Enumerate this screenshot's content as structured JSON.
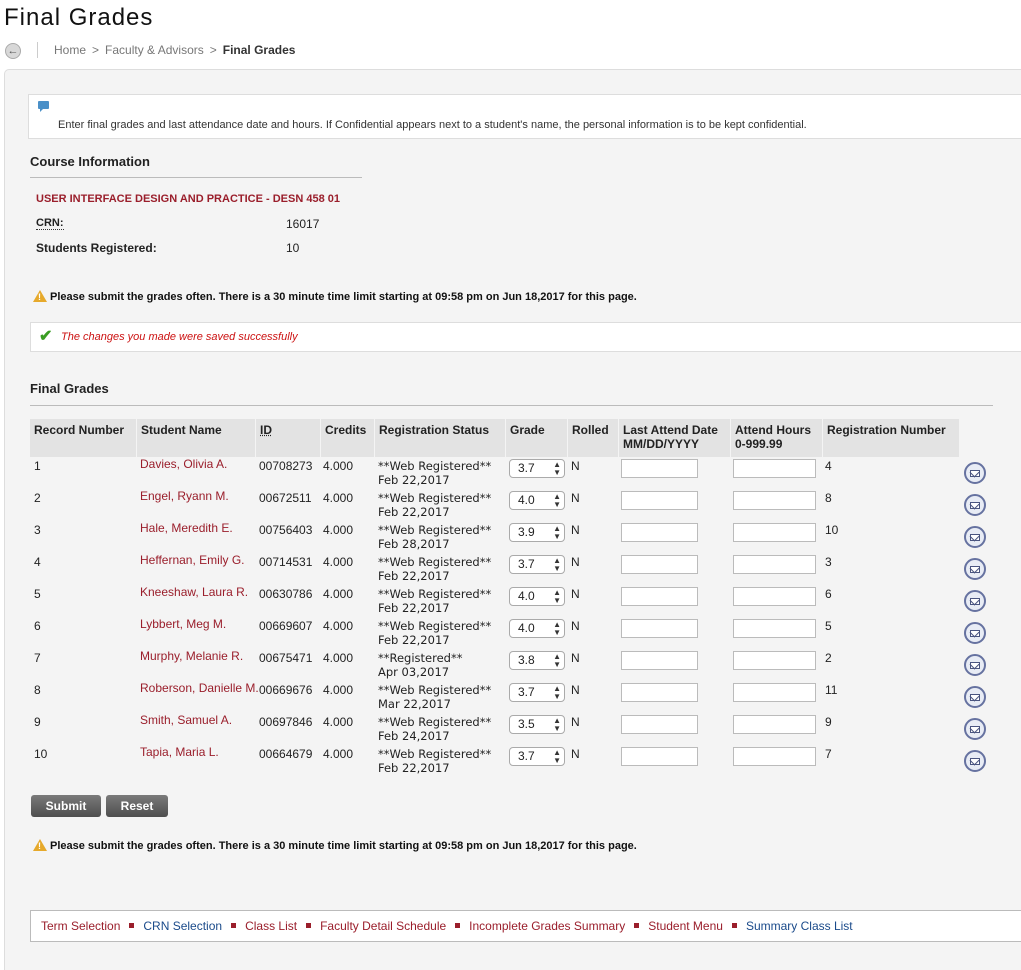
{
  "page": {
    "title": "Final Grades"
  },
  "breadcrumb": {
    "home": "Home",
    "faculty": "Faculty & Advisors",
    "current": "Final Grades",
    "separator": ">"
  },
  "info": {
    "text": "Enter final grades and last attendance date and hours. If Confidential appears next to a student's name, the personal information is to be kept confidential."
  },
  "course": {
    "heading": "Course Information",
    "title": "USER INTERFACE DESIGN AND PRACTICE - DESN 458 01",
    "crn_label": "CRN:",
    "crn_value": "16017",
    "students_label": "Students Registered:",
    "students_value": "10"
  },
  "warning": {
    "text": "Please submit the grades often. There is a 30 minute time limit starting at 09:58 pm on Jun 18,2017 for this page."
  },
  "success": {
    "text": "The changes you made were saved successfully"
  },
  "grades": {
    "heading": "Final Grades",
    "headers": {
      "record": "Record Number",
      "name": "Student Name",
      "id": "ID",
      "credits": "Credits",
      "status": "Registration Status",
      "grade": "Grade",
      "rolled": "Rolled",
      "attend_date_1": "Last Attend Date",
      "attend_date_2": "MM/DD/YYYY",
      "attend_hours_1": "Attend Hours",
      "attend_hours_2": "0-999.99",
      "reg_number": "Registration Number"
    },
    "rows": [
      {
        "record": "1",
        "name": "Davies, Olivia A.",
        "id": "00708273",
        "credits": "4.000",
        "status1": "**Web Registered**",
        "status2": "Feb 22,2017",
        "grade": "3.7",
        "rolled": "N",
        "reg": "4"
      },
      {
        "record": "2",
        "name": "Engel, Ryann M.",
        "id": "00672511",
        "credits": "4.000",
        "status1": "**Web Registered**",
        "status2": "Feb 22,2017",
        "grade": "4.0",
        "rolled": "N",
        "reg": "8"
      },
      {
        "record": "3",
        "name": "Hale, Meredith E.",
        "id": "00756403",
        "credits": "4.000",
        "status1": "**Web Registered**",
        "status2": "Feb 28,2017",
        "grade": "3.9",
        "rolled": "N",
        "reg": "10"
      },
      {
        "record": "4",
        "name": "Heffernan, Emily G.",
        "id": "00714531",
        "credits": "4.000",
        "status1": "**Web Registered**",
        "status2": "Feb 22,2017",
        "grade": "3.7",
        "rolled": "N",
        "reg": "3"
      },
      {
        "record": "5",
        "name": "Kneeshaw, Laura R.",
        "id": "00630786",
        "credits": "4.000",
        "status1": "**Web Registered**",
        "status2": "Feb 22,2017",
        "grade": "4.0",
        "rolled": "N",
        "reg": "6"
      },
      {
        "record": "6",
        "name": "Lybbert, Meg M.",
        "id": "00669607",
        "credits": "4.000",
        "status1": "**Web Registered**",
        "status2": "Feb 22,2017",
        "grade": "4.0",
        "rolled": "N",
        "reg": "5"
      },
      {
        "record": "7",
        "name": "Murphy, Melanie R.",
        "id": "00675471",
        "credits": "4.000",
        "status1": "**Registered**",
        "status2": "Apr 03,2017",
        "grade": "3.8",
        "rolled": "N",
        "reg": "2"
      },
      {
        "record": "8",
        "name": "Roberson, Danielle M.",
        "id": "00669676",
        "credits": "4.000",
        "status1": "**Web Registered**",
        "status2": "Mar 22,2017",
        "grade": "3.7",
        "rolled": "N",
        "reg": "11"
      },
      {
        "record": "9",
        "name": "Smith, Samuel A.",
        "id": "00697846",
        "credits": "4.000",
        "status1": "**Web Registered**",
        "status2": "Feb 24,2017",
        "grade": "3.5",
        "rolled": "N",
        "reg": "9"
      },
      {
        "record": "10",
        "name": "Tapia, Maria L.",
        "id": "00664679",
        "credits": "4.000",
        "status1": "**Web Registered**",
        "status2": "Feb 22,2017",
        "grade": "3.7",
        "rolled": "N",
        "reg": "7"
      }
    ]
  },
  "buttons": {
    "submit": "Submit",
    "reset": "Reset"
  },
  "footer": {
    "links": [
      {
        "label": "Term Selection",
        "color": "maroon"
      },
      {
        "label": "CRN Selection",
        "color": "blue"
      },
      {
        "label": "Class List",
        "color": "maroon"
      },
      {
        "label": "Faculty Detail Schedule",
        "color": "maroon"
      },
      {
        "label": "Incomplete Grades Summary",
        "color": "maroon"
      },
      {
        "label": "Student Menu",
        "color": "maroon"
      },
      {
        "label": "Summary Class List",
        "color": "blue"
      }
    ]
  },
  "colors": {
    "accent": "#9a1e2b",
    "link_blue": "#1a4a8a",
    "success": "#cc1111",
    "warning_icon": "#e6a92b"
  },
  "icons": {
    "back": "back-arrow-icon",
    "info": "speech-bubble-icon",
    "warning": "warning-triangle-icon",
    "success": "check-icon",
    "email": "envelope-icon"
  }
}
